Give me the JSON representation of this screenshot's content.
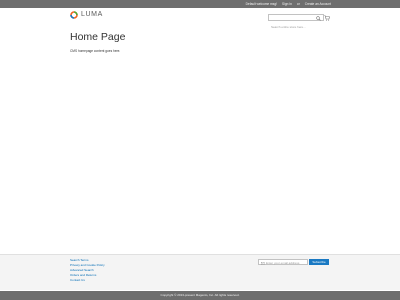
{
  "header": {
    "welcome": "Default welcome msg!",
    "sign_in": "Sign In",
    "or": "or",
    "create_account": "Create an Account",
    "logo_text": "LUMA",
    "search_placeholder": "Search entire store here...",
    "cart_icon": "cart-icon",
    "search_icon": "search-icon"
  },
  "main": {
    "title": "Home Page",
    "content": "CMS homepage content goes here."
  },
  "footer": {
    "links": [
      "Search Terms",
      "Privacy and Cookie Policy",
      "Advanced Search",
      "Orders and Returns",
      "Contact Us"
    ],
    "newsletter_placeholder": "Enter your email address",
    "subscribe_label": "Subscribe",
    "copyright": "Copyright © 2013-present Magento, Inc. All rights reserved."
  },
  "colors": {
    "topbar": "#6e6e6e",
    "link": "#006bb4",
    "button": "#1979c3",
    "logo_orange": "#f26322",
    "logo_green": "#53a834"
  }
}
